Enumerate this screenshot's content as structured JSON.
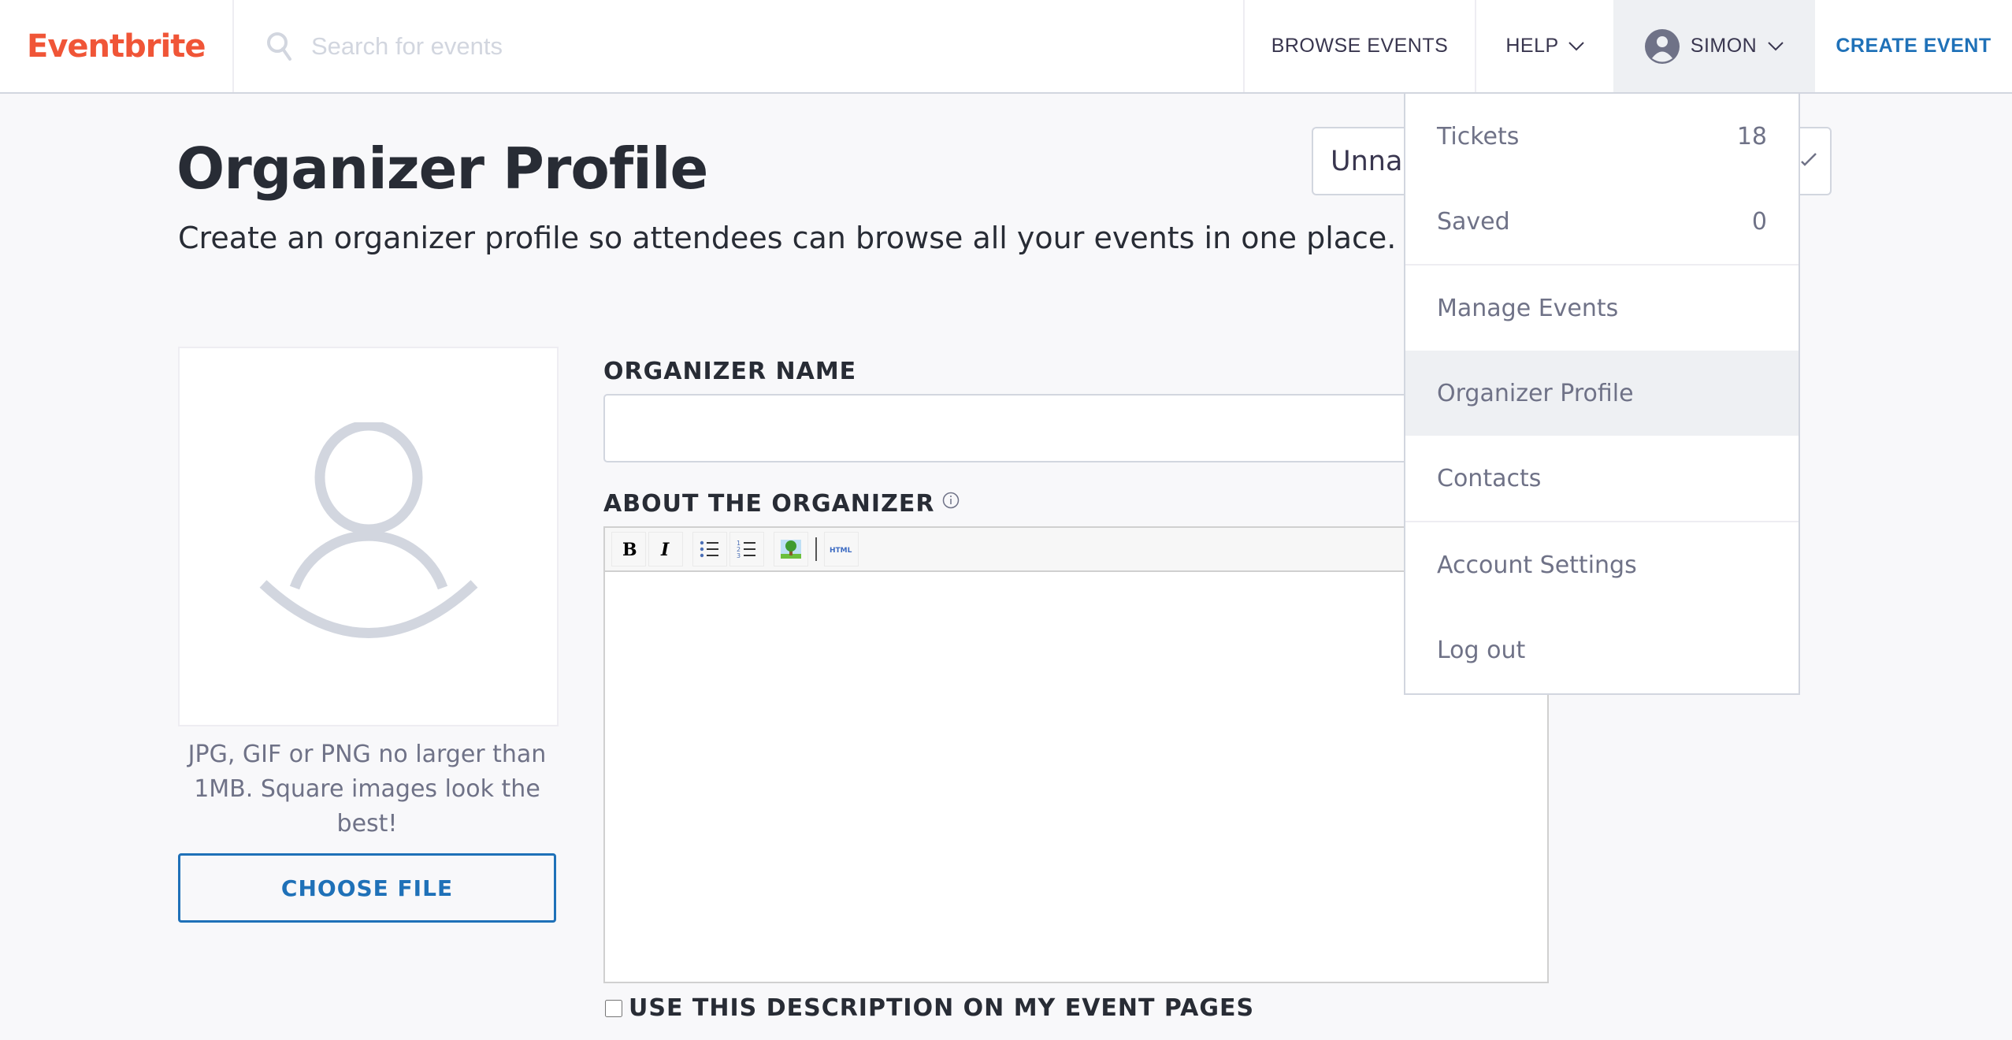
{
  "header": {
    "logo": "Eventbrite",
    "search_placeholder": "Search for events",
    "search_value": "",
    "browse_events": "BROWSE EVENTS",
    "help": "HELP",
    "user_name": "SIMON",
    "create_event": "CREATE EVENT"
  },
  "colors": {
    "brand": "#f05537",
    "link_blue": "#1f71b8",
    "active_bg": "#eef0f3"
  },
  "page": {
    "title": "Organizer Profile",
    "subtitle": "Create an organizer profile so attendees can browse all your events in one place.",
    "organizer_select_value": "Unnamed organizer"
  },
  "image_upload": {
    "hint": "JPG, GIF or PNG no larger than 1MB. Square images look the best!",
    "button": "CHOOSE FILE"
  },
  "form": {
    "name_label": "ORGANIZER NAME",
    "name_value": "",
    "about_label": "ABOUT THE ORGANIZER",
    "about_value": "",
    "toolbar": [
      "bold",
      "italic",
      "bulleted-list",
      "numbered-list",
      "insert-image",
      "html"
    ],
    "html_label": "HTML",
    "use_description_label": "USE THIS DESCRIPTION ON MY EVENT PAGES",
    "use_description_checked": false
  },
  "user_menu": {
    "groups": [
      [
        {
          "label": "Tickets",
          "count": "18"
        },
        {
          "label": "Saved",
          "count": "0"
        }
      ],
      [
        {
          "label": "Manage Events"
        },
        {
          "label": "Organizer Profile",
          "active": true
        },
        {
          "label": "Contacts"
        }
      ],
      [
        {
          "label": "Account Settings"
        },
        {
          "label": "Log out"
        }
      ]
    ]
  }
}
